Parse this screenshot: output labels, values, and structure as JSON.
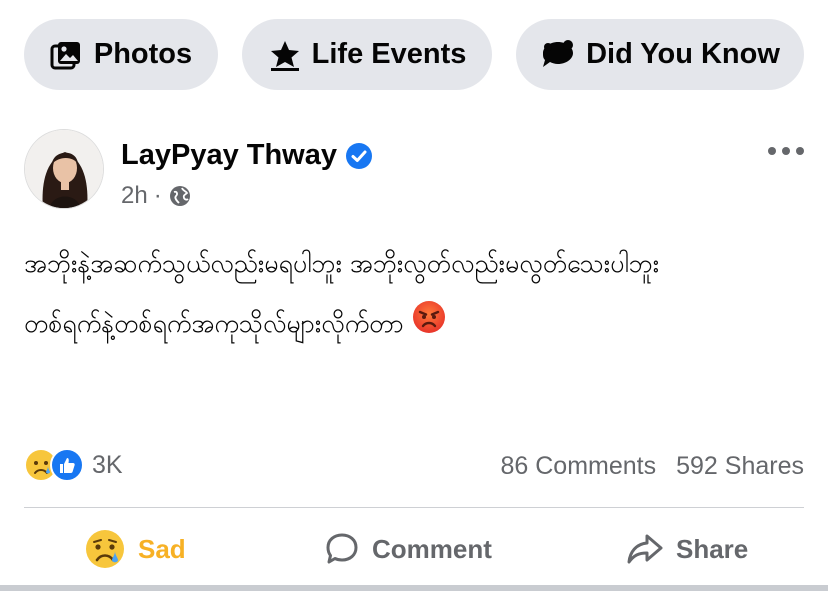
{
  "chips": {
    "photos": {
      "label": "Photos",
      "icon": "photos-icon"
    },
    "life_events": {
      "label": "Life Events",
      "icon": "star-icon"
    },
    "did_you_know": {
      "label": "Did You Know",
      "icon": "speech-bubble-icon"
    }
  },
  "post": {
    "author": "LayPyay Thway",
    "verified": true,
    "time": "2h",
    "separator": "·",
    "audience_icon": "globe-icon",
    "text_lines": [
      "အဘိုးနဲ့အဆက်သွယ်လည်းမရပါဘူး အဘိုးလွတ်လည်းမလွတ်သေးပါဘူး",
      "တစ်ရက်နဲ့တစ်ရက်အကုသိုလ်များလိုက်တာ"
    ],
    "trailing_emoji": "angry-face-emoji"
  },
  "stats": {
    "reaction_count": "3K",
    "comments": "86 Comments",
    "shares": "592 Shares"
  },
  "actions": {
    "sad_label": "Sad",
    "comment_label": "Comment",
    "share_label": "Share"
  },
  "colors": {
    "chip_bg": "#e4e6eb",
    "verified_blue": "#1877f2",
    "sad_yellow": "#f7b125",
    "meta_gray": "#65676b"
  }
}
